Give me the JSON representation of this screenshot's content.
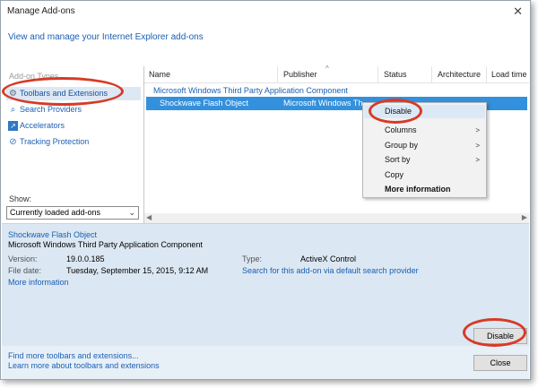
{
  "window": {
    "title": "Manage Add-ons",
    "subtitle_link": "View and manage your Internet Explorer add-ons"
  },
  "sidebar": {
    "addon_types_label": "Add-on Types",
    "items": [
      {
        "label": "Toolbars and Extensions",
        "icon": "gear-icon"
      },
      {
        "label": "Search Providers",
        "icon": "search-icon"
      },
      {
        "label": "Accelerators",
        "icon": "accelerator-icon"
      },
      {
        "label": "Tracking Protection",
        "icon": "no-entry-icon"
      }
    ],
    "show_label": "Show:",
    "show_value": "Currently loaded add-ons"
  },
  "list": {
    "columns": [
      "Name",
      "Publisher",
      "Status",
      "Architecture",
      "Load time"
    ],
    "group": "Microsoft Windows Third Party Application Component",
    "selected_row": {
      "name": "Shockwave Flash Object",
      "publisher": "Microsoft Windows Th",
      "status": "",
      "architecture": ""
    }
  },
  "context_menu": {
    "items": [
      {
        "label": "Disable",
        "submenu": false,
        "bold": false
      },
      {
        "label": "Columns",
        "submenu": true,
        "bold": false
      },
      {
        "label": "Group by",
        "submenu": true,
        "bold": false
      },
      {
        "label": "Sort by",
        "submenu": true,
        "bold": false
      },
      {
        "label": "Copy",
        "submenu": false,
        "bold": false
      },
      {
        "label": "More information",
        "submenu": false,
        "bold": true
      }
    ]
  },
  "details": {
    "name": "Shockwave Flash Object",
    "publisher": "Microsoft Windows Third Party Application Component",
    "version_label": "Version:",
    "version": "19.0.0.185",
    "filedate_label": "File date:",
    "filedate": "Tuesday, September 15, 2015, 9:12 AM",
    "more_info": "More information",
    "type_label": "Type:",
    "type": "ActiveX Control",
    "search_link": "Search for this add-on via default search provider",
    "disable_button": "Disable"
  },
  "footer": {
    "find_more": "Find more toolbars and extensions...",
    "learn_more": "Learn more about toolbars and extensions",
    "close_button": "Close"
  },
  "colors": {
    "highlight_ring": "#d73a26",
    "selection": "#3390dc",
    "link": "#1a5fb4"
  }
}
